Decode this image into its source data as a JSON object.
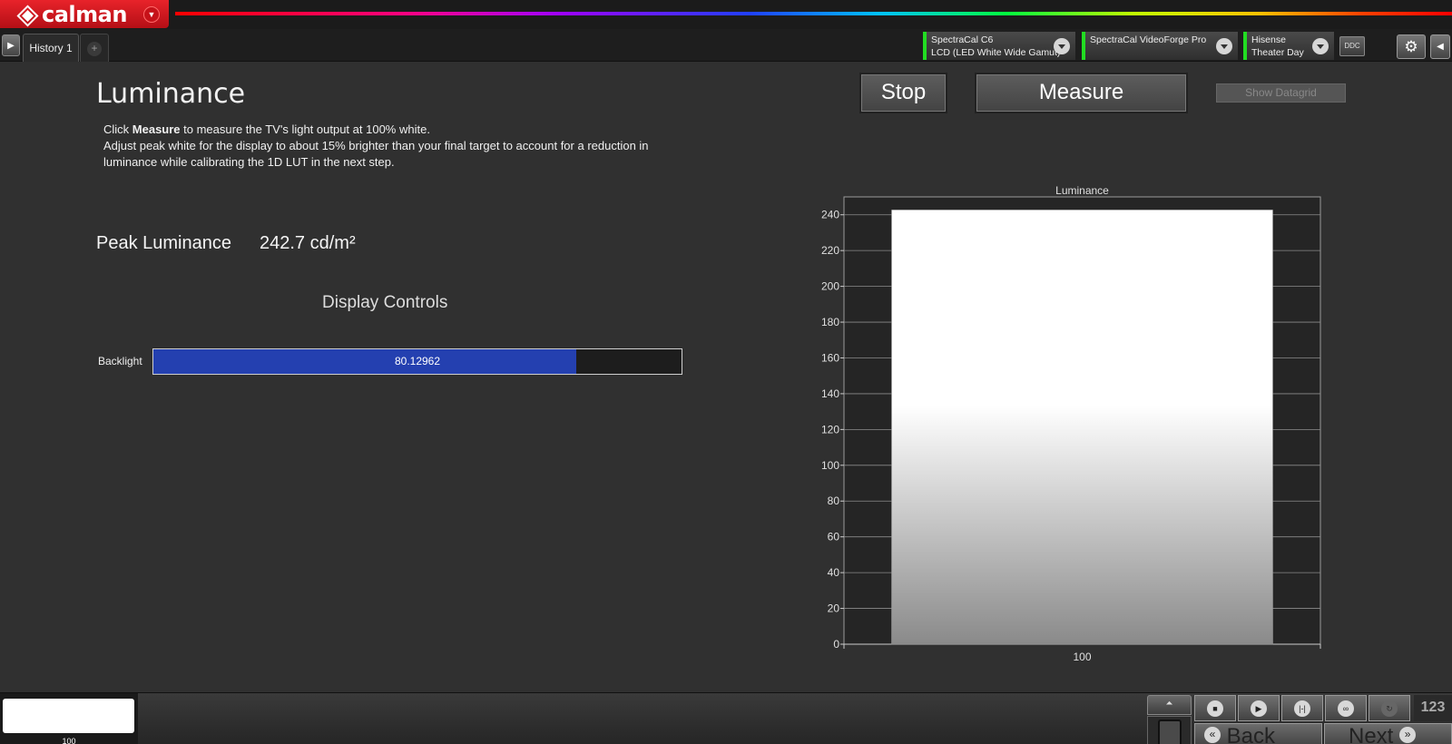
{
  "app": {
    "logo_text": "calman"
  },
  "tabs": [
    {
      "label": "History 1"
    }
  ],
  "tab_add_label": "+",
  "devices": {
    "meter": {
      "line1": "SpectraCal C6",
      "line2": "LCD (LED White Wide Gamut)"
    },
    "source": {
      "line1": "SpectraCal VideoForge Pro",
      "line2": ""
    },
    "display": {
      "line1": "Hisense",
      "line2": "Theater Day"
    },
    "ddc_label": "DDC"
  },
  "page": {
    "title": "Luminance",
    "instr_prefix": "Click ",
    "instr_bold": "Measure",
    "instr_rest": " to measure the TV's light output at 100% white.",
    "instr_line2": "Adjust peak white for the display to about 15% brighter than your final target to account for a reduction in luminance while calibrating the 1D LUT in the next step."
  },
  "buttons": {
    "stop": "Stop",
    "measure": "Measure",
    "datagrid": "Show Datagrid"
  },
  "peak": {
    "label": "Peak Luminance",
    "value": "242.7 cd/m²"
  },
  "display_controls": {
    "heading": "Display Controls",
    "backlight_label": "Backlight",
    "backlight_value": "80.12962",
    "backlight_fraction": 0.8
  },
  "chart_data": {
    "type": "bar",
    "title": "Luminance",
    "categories": [
      "100"
    ],
    "values": [
      242.7
    ],
    "ylim": [
      0,
      250
    ],
    "yticks": [
      0,
      20,
      40,
      60,
      80,
      100,
      120,
      140,
      160,
      180,
      200,
      220,
      240
    ],
    "grid": true,
    "bar_color": "#ffffff",
    "plot_bg": "#252525"
  },
  "bottom": {
    "swatch_label": "100",
    "swatch_color": "#ffffff",
    "counter": "123",
    "back": "Back",
    "next": "Next"
  },
  "colors": {
    "accent_red": "#e8232a",
    "status_green": "#22dd22",
    "slider_blue": "#2440b0"
  }
}
